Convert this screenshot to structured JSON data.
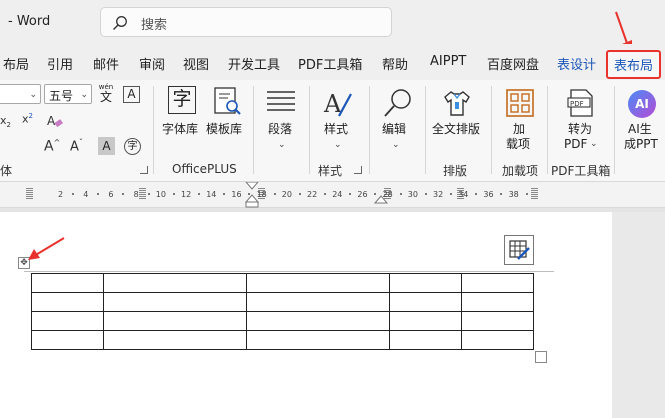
{
  "titlebar": {
    "title": "-  Word",
    "search_placeholder": "搜索"
  },
  "tabs": [
    "布局",
    "引用",
    "邮件",
    "审阅",
    "视图",
    "开发工具",
    "PDF工具箱",
    "帮助",
    "AIPPT",
    "百度网盘",
    "表设计",
    "表布局"
  ],
  "font": {
    "size_value": "五号",
    "wen_label": "wén",
    "wen_char": "文",
    "A_box": "A",
    "dropcap": "A",
    "circle_char": "字"
  },
  "groups": {
    "officeplus": {
      "label": "OfficePLUS",
      "btn_fonts": "字体库",
      "btn_templates": "模板库"
    },
    "paragraph": {
      "btn": "段落"
    },
    "styles": {
      "label": "样式",
      "btn": "样式"
    },
    "edit": {
      "btn": "编辑"
    },
    "layout": {
      "label": "排版",
      "btn": "全文排版"
    },
    "addins": {
      "label": "加载项",
      "btn_line1": "加",
      "btn_line2": "载项"
    },
    "pdf": {
      "label": "PDF工具箱",
      "btn_line1": "转为",
      "btn_line2": "PDF"
    },
    "ai": {
      "btn_line1": "AI生",
      "btn_line2": "成PPT"
    },
    "font_group_label": "体"
  },
  "ruler": {
    "ticks": [
      "2",
      "4",
      "6",
      "8",
      "10",
      "12",
      "14",
      "16",
      "18",
      "20",
      "22",
      "24",
      "26",
      "28",
      "30",
      "32",
      "34",
      "36",
      "38"
    ]
  },
  "table": {
    "rows": 4,
    "cols": 5
  },
  "colors": {
    "accent": "#1a56b8",
    "highlight": "#e8322b"
  }
}
